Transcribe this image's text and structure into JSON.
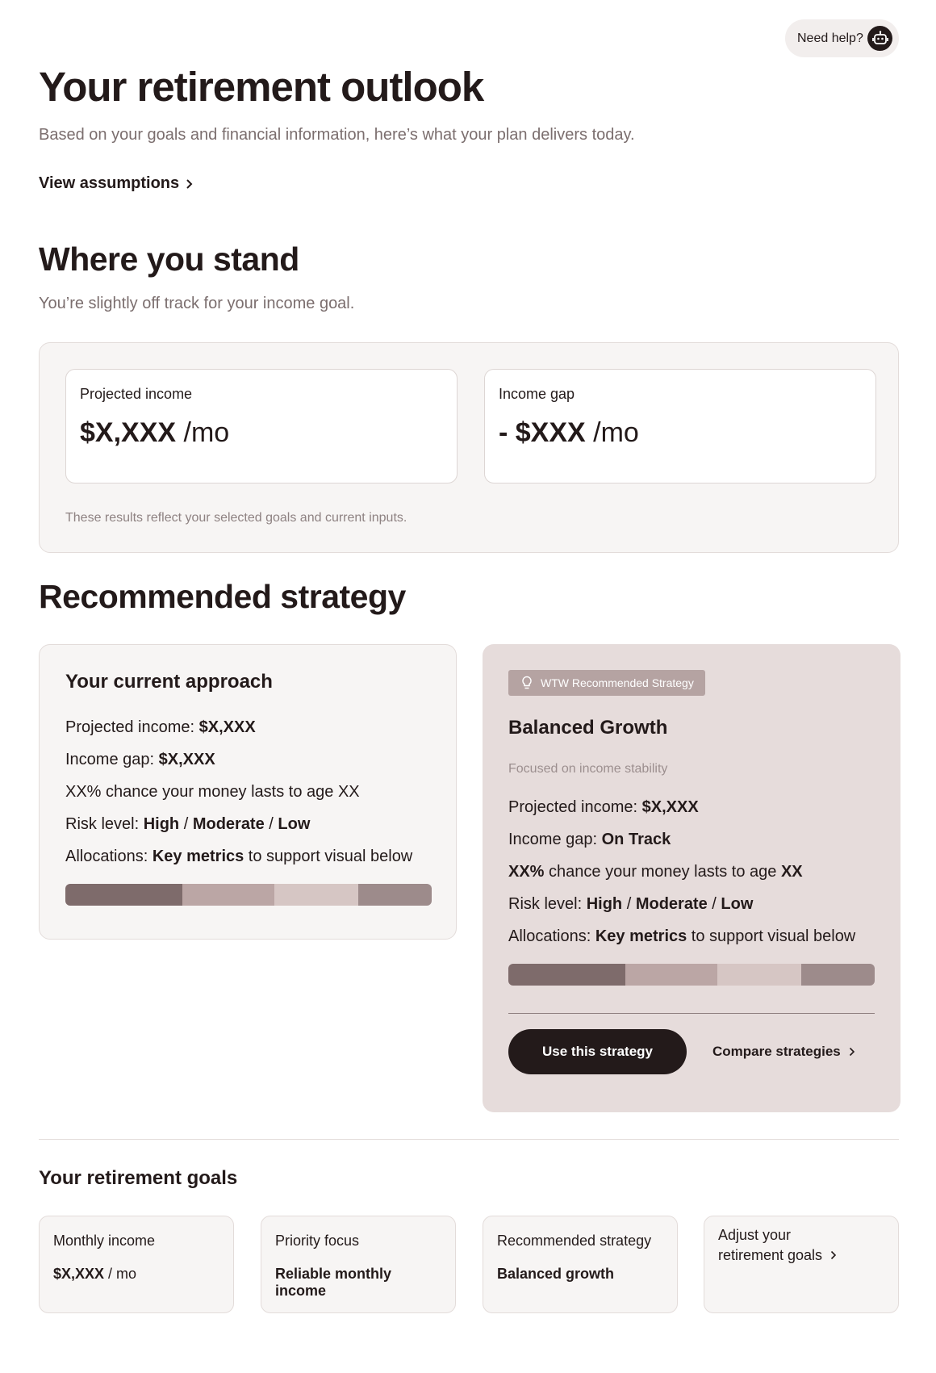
{
  "help": {
    "label": "Need help?",
    "icon": "robot-icon"
  },
  "header": {
    "title": "Your retirement outlook",
    "subtitle": "Based on your goals and financial information, here’s what your plan delivers today.",
    "assumptions_link": "View assumptions"
  },
  "stand": {
    "title": "Where you stand",
    "subtitle": "You’re slightly off track for your income goal.",
    "projected": {
      "label": "Projected income",
      "value": "$X,XXX",
      "unit": " /mo"
    },
    "gap": {
      "label": "Income gap",
      "value": "- $XXX",
      "unit": " /mo"
    },
    "note": "These results reflect your selected goals and current inputs."
  },
  "recommended": {
    "title": "Recommended strategy",
    "current": {
      "title": "Your current approach",
      "projected_label": "Projected income: ",
      "projected_value": "$X,XXX",
      "gap_label": "Income gap: ",
      "gap_value": "$X,XXX",
      "chance_text": "XX% chance your money lasts to age XX",
      "risk_label": "Risk level: ",
      "risk_high": "High",
      "risk_moderate": "Moderate",
      "risk_low": "Low",
      "risk_sep": " / ",
      "alloc_label": "Allocations: ",
      "alloc_key": "Key metrics",
      "alloc_rest": " to support visual below",
      "allocations": [
        0.32,
        0.25,
        0.23,
        0.2
      ]
    },
    "strategy": {
      "badge": "WTW Recommended Strategy",
      "title": "Balanced Growth",
      "focus": "Focused on income stability",
      "projected_label": "Projected income: ",
      "projected_value": "$X,XXX",
      "gap_label": "Income gap: ",
      "gap_value": "On Track",
      "chance_pct": "XX%",
      "chance_mid": " chance your money lasts to age ",
      "chance_age": "XX",
      "risk_label": "Risk level: ",
      "risk_high": "High",
      "risk_moderate": "Moderate",
      "risk_low": "Low",
      "risk_sep": " / ",
      "alloc_label": "Allocations: ",
      "alloc_key": "Key metrics",
      "alloc_rest": " to support visual below",
      "allocations": [
        0.32,
        0.25,
        0.23,
        0.2
      ],
      "use_button": "Use this strategy",
      "compare_link": "Compare strategies"
    }
  },
  "allocation_colors": [
    "#7e6b6b",
    "#bba6a5",
    "#d6c6c4",
    "#9d8b8b"
  ],
  "goals": {
    "title": "Your retirement goals",
    "monthly": {
      "label": "Monthly income",
      "value": "$X,XXX",
      "unit": " / mo"
    },
    "priority": {
      "label": "Priority focus",
      "value": "Reliable monthly income"
    },
    "strategy": {
      "label": "Recommended strategy",
      "value": "Balanced growth"
    },
    "adjust_link": "Adjust your retirement goals"
  }
}
